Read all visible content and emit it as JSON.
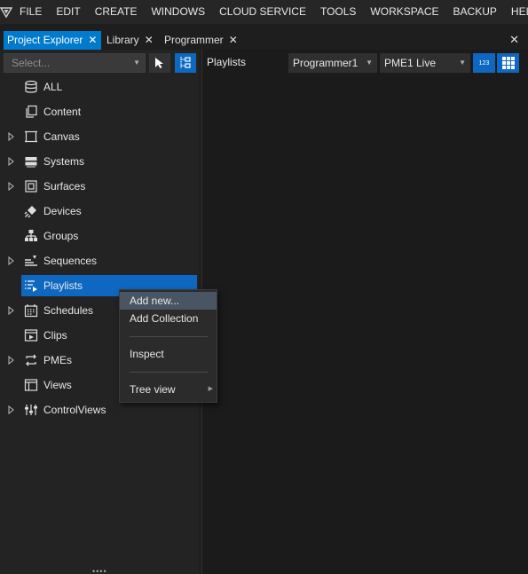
{
  "menubar": {
    "items": [
      "FILE",
      "EDIT",
      "CREATE",
      "WINDOWS",
      "CLOUD SERVICE",
      "TOOLS",
      "WORKSPACE",
      "BACKUP",
      "HELP"
    ]
  },
  "tabs": [
    {
      "label": "Project Explorer",
      "active": true
    },
    {
      "label": "Library",
      "active": false
    },
    {
      "label": "Programmer",
      "active": false
    }
  ],
  "tab_close_glyph": "✕",
  "explorer": {
    "select_placeholder": "Select...",
    "items": [
      {
        "label": "ALL",
        "icon": "database-icon",
        "expandable": false
      },
      {
        "label": "Content",
        "icon": "content-icon",
        "expandable": false
      },
      {
        "label": "Canvas",
        "icon": "canvas-icon",
        "expandable": true
      },
      {
        "label": "Systems",
        "icon": "systems-icon",
        "expandable": true
      },
      {
        "label": "Surfaces",
        "icon": "surfaces-icon",
        "expandable": true
      },
      {
        "label": "Devices",
        "icon": "devices-icon",
        "expandable": false
      },
      {
        "label": "Groups",
        "icon": "groups-icon",
        "expandable": false
      },
      {
        "label": "Sequences",
        "icon": "sequences-icon",
        "expandable": true
      },
      {
        "label": "Playlists",
        "icon": "playlists-icon",
        "expandable": false,
        "selected": true
      },
      {
        "label": "Schedules",
        "icon": "schedules-icon",
        "expandable": true
      },
      {
        "label": "Clips",
        "icon": "clips-icon",
        "expandable": false
      },
      {
        "label": "PMEs",
        "icon": "pmes-icon",
        "expandable": true
      },
      {
        "label": "Views",
        "icon": "views-icon",
        "expandable": false
      },
      {
        "label": "ControlViews",
        "icon": "controlviews-icon",
        "expandable": true
      }
    ]
  },
  "context_menu": {
    "items": [
      {
        "label": "Add new...",
        "hover": true
      },
      {
        "label": "Add Collection"
      },
      {
        "label": "Inspect"
      },
      {
        "label": "Tree view",
        "submenu": true
      }
    ]
  },
  "playlists_panel": {
    "title": "Playlists",
    "programmer_value": "Programmer1",
    "pme_value": "PME1 Live",
    "numeric_button_label": "123"
  },
  "colors": {
    "accent": "#007acc",
    "selection": "#0e68c1",
    "menu_hover": "#4a5564"
  }
}
